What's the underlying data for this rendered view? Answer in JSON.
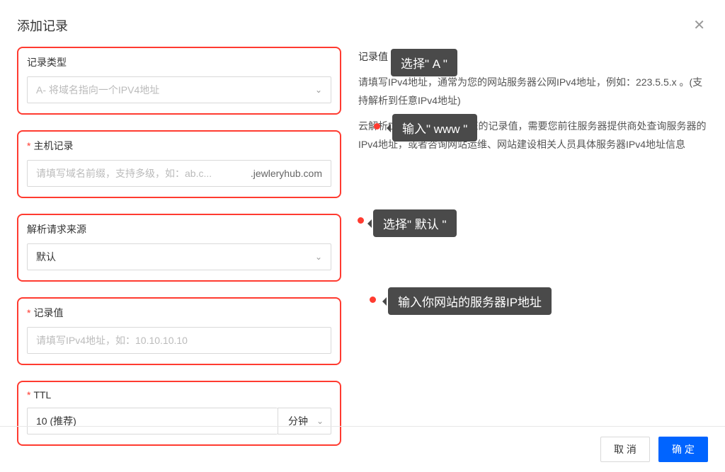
{
  "modal": {
    "title": "添加记录"
  },
  "fields": {
    "recordType": {
      "label": "记录类型",
      "value": "A- 将域名指向一个IPV4地址"
    },
    "host": {
      "label": "主机记录",
      "placeholder": "请填写域名前缀，支持多级，如：ab.c...",
      "suffix": ".jewleryhub.com"
    },
    "source": {
      "label": "解析请求来源",
      "value": "默认"
    },
    "value": {
      "label": "记录值",
      "placeholder": "请填写IPv4地址，如：10.10.10.10"
    },
    "ttl": {
      "label": "TTL",
      "value": "10 (推荐)",
      "unit": "分钟"
    }
  },
  "help": {
    "title": "记录值",
    "text1": "请填写IPv4地址，通常为您的网站服务器公网IPv4地址，例如：223.5.5.x 。(支持解析到任意IPv4地址)",
    "text2": "云解析DNS产品无法知晓您的记录值，需要您前往服务器提供商处查询服务器的IPv4地址，或者咨询网站运维、网站建设相关人员具体服务器IPv4地址信息"
  },
  "annotations": {
    "b1": "选择\" A \"",
    "b2": "输入\" www \"",
    "b3": "选择\" 默认 \"",
    "b4": "输入你网站的服务器IP地址"
  },
  "buttons": {
    "cancel": "取 消",
    "confirm": "确 定"
  }
}
